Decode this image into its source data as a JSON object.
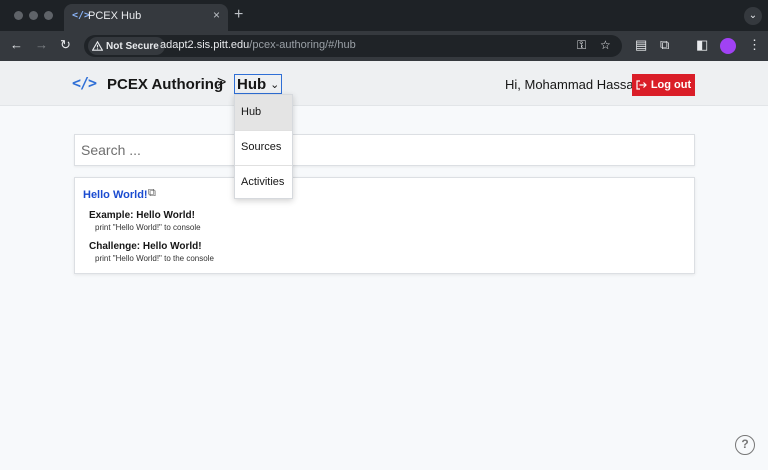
{
  "browser": {
    "tab_title": "PCEX Hub",
    "tab_favicon": "</>",
    "tab_close": "×",
    "new_tab": "+",
    "tab_menu": "⌄",
    "security_label": "Not Secure",
    "url_host": "adapt2.sis.pitt.edu",
    "url_path": "/pcex-authoring/#/hub",
    "icons": [
      "back-icon",
      "forward-icon",
      "reload-icon",
      "warning-icon",
      "key-icon",
      "star-icon",
      "reading-list-icon",
      "extensions-icon",
      "side-panel-icon",
      "profile-icon",
      "menu-icon"
    ]
  },
  "header": {
    "logo": "</>",
    "brand": "PCEX Authoring",
    "separator": ">",
    "current": "Hub",
    "greeting": "Hi, Mohammad Hassany",
    "logout_label": "Log out"
  },
  "dropdown": {
    "items": [
      "Hub",
      "Sources",
      "Activities"
    ],
    "selected": "Hub"
  },
  "search": {
    "placeholder": "Search ..."
  },
  "card": {
    "title": "Hello World!",
    "items": [
      {
        "title": "Example: Hello World!",
        "description": "print \"Hello World!\" to console"
      },
      {
        "title": "Challenge: Hello World!",
        "description": "print \"Hello World!\" to the console"
      }
    ]
  },
  "help_label": "?",
  "colors": {
    "accent": "#2f6fd6",
    "link": "#1a4bd0",
    "danger": "#da1e28",
    "page_bg": "#f7f9fb"
  }
}
